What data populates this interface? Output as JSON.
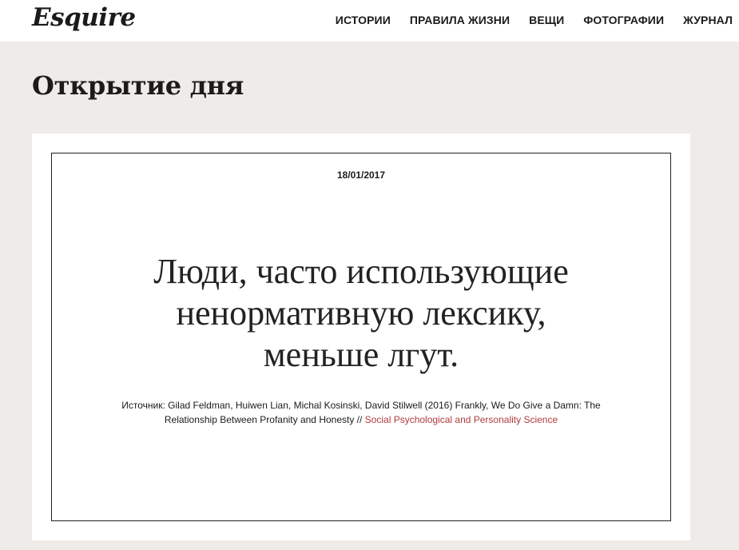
{
  "header": {
    "logo": "Esquire",
    "nav": [
      {
        "label": "ИСТОРИИ"
      },
      {
        "label": "ПРАВИЛА ЖИЗНИ"
      },
      {
        "label": "ВЕЩИ"
      },
      {
        "label": "ФОТОГРАФИИ"
      },
      {
        "label": "ЖУРНАЛ"
      }
    ]
  },
  "page": {
    "title": "Открытие дня"
  },
  "card": {
    "date": "18/01/2017",
    "headline_lines": [
      "Люди, часто использующие",
      "ненормативную лексику,",
      "меньше лгут."
    ],
    "source_text": "Источник: Gilad Feldman, Huiwen Lian, Michal Kosinski, David Stilwell (2016) Frankly, We Do Give a Damn: The Relationship Between Profanity and Honesty // ",
    "source_link": "Social Psychological and Personality Science"
  },
  "colors": {
    "background": "#efebe9",
    "link": "#b23b3b"
  }
}
